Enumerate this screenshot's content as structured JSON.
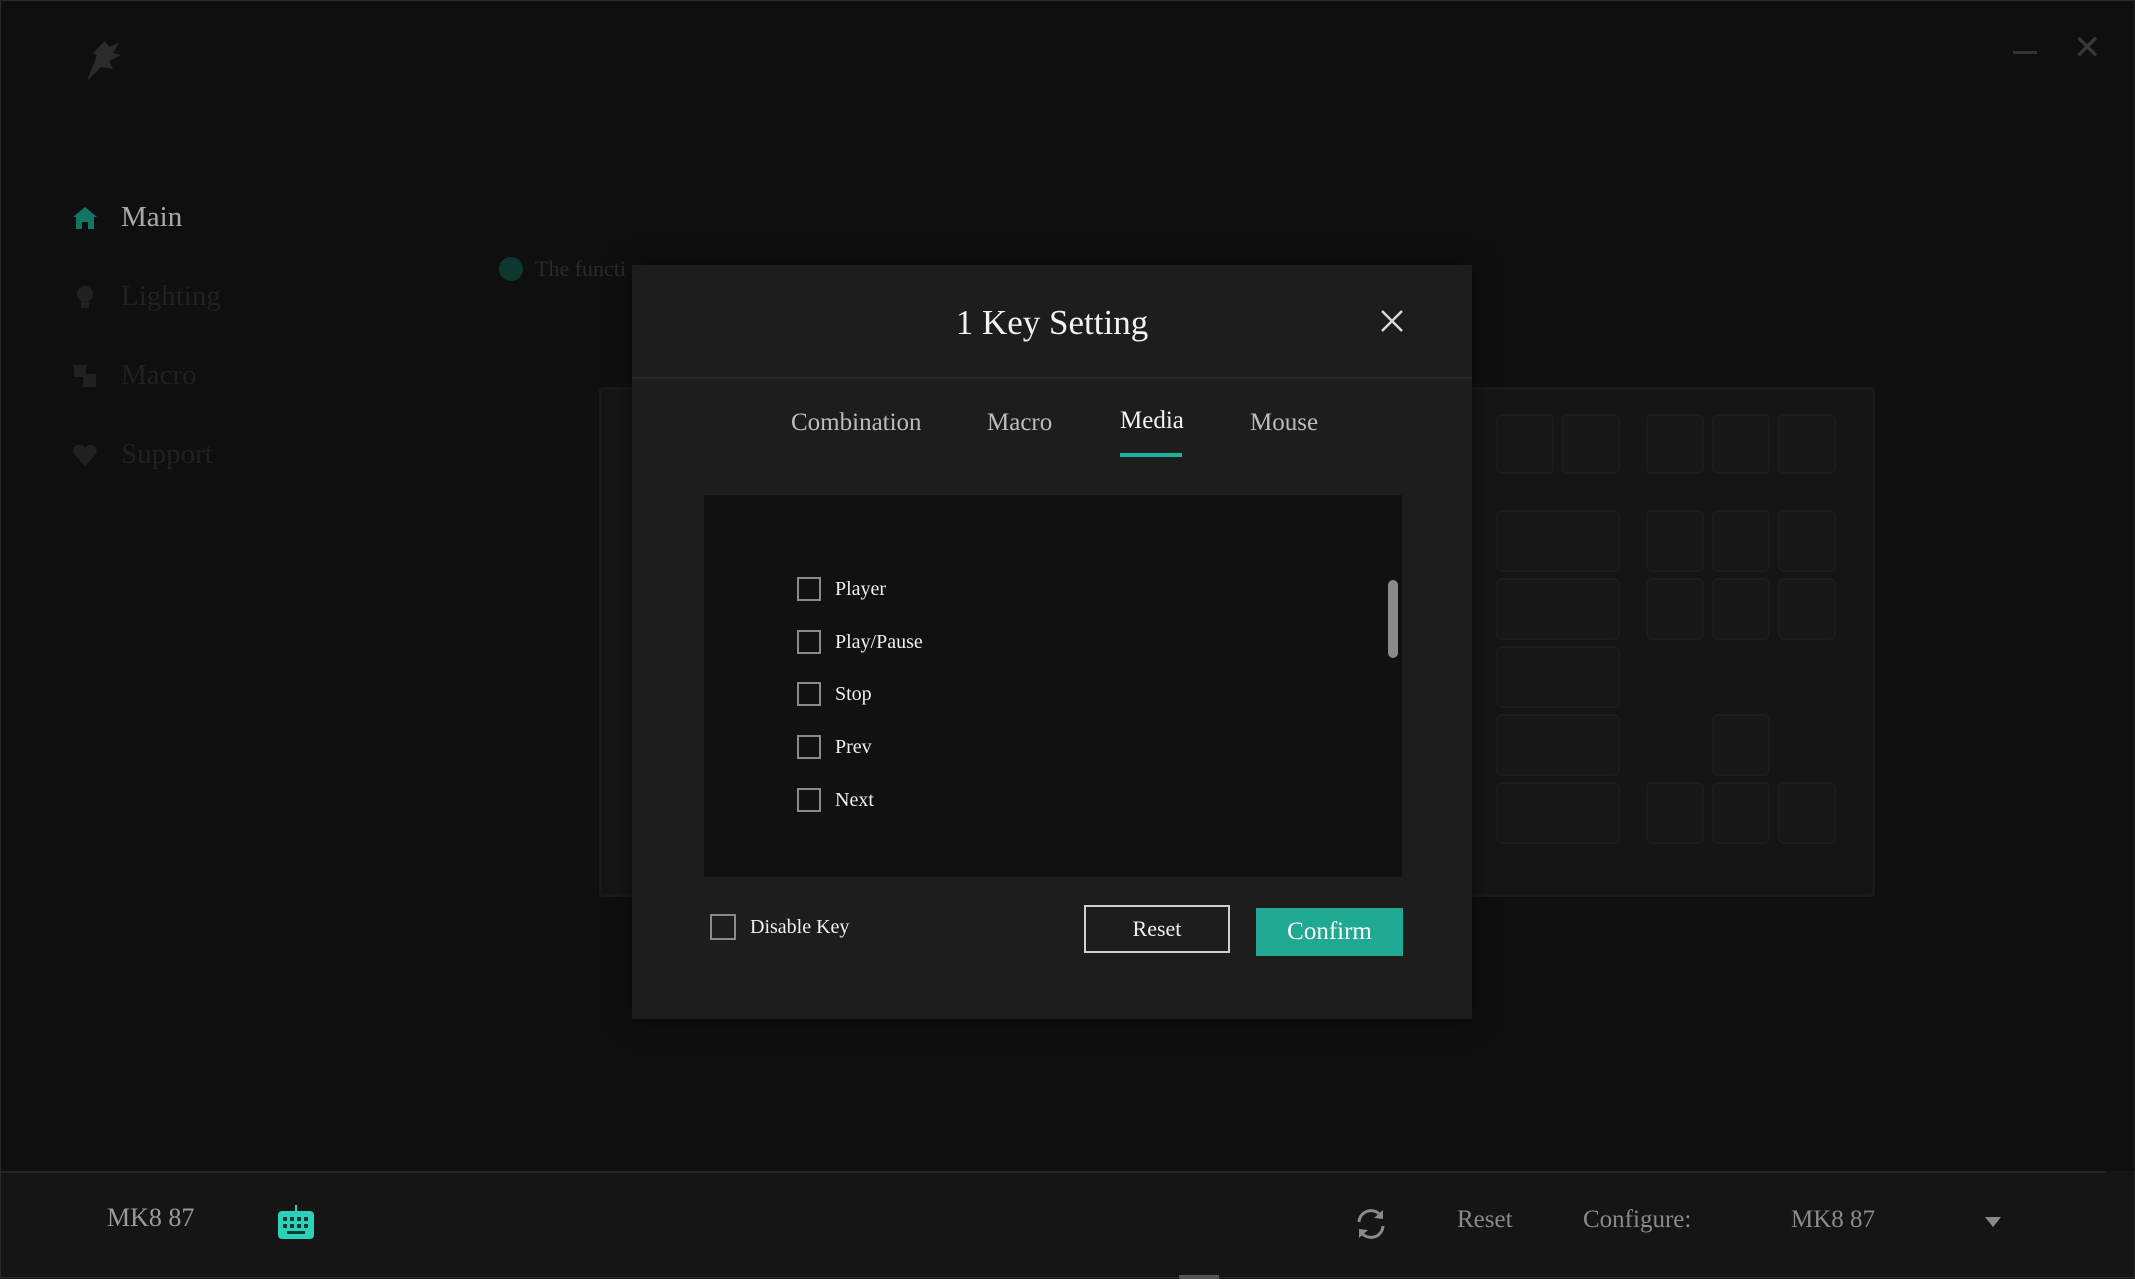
{
  "sidebar": {
    "items": [
      {
        "label": "Main",
        "icon": "home-icon"
      },
      {
        "label": "Lighting",
        "icon": "bulb-icon"
      },
      {
        "label": "Macro",
        "icon": "macro-icon"
      },
      {
        "label": "Support",
        "icon": "heart-icon"
      }
    ]
  },
  "hint": {
    "text": "The functi"
  },
  "modal": {
    "title": "1 Key Setting",
    "tabs": [
      {
        "label": "Combination"
      },
      {
        "label": "Macro"
      },
      {
        "label": "Media"
      },
      {
        "label": "Mouse"
      }
    ],
    "active_tab": "Media",
    "options": [
      {
        "label": "Player",
        "checked": false
      },
      {
        "label": "Play/Pause",
        "checked": false
      },
      {
        "label": "Stop",
        "checked": false
      },
      {
        "label": "Prev",
        "checked": false
      },
      {
        "label": "Next",
        "checked": false
      }
    ],
    "disable_key_label": "Disable Key",
    "reset_label": "Reset",
    "confirm_label": "Confirm"
  },
  "footer": {
    "device_name": "MK8 87",
    "reset_label": "Reset",
    "configure_label": "Configure:",
    "configure_value": "MK8 87"
  },
  "colors": {
    "accent": "#1fa892",
    "background": "#151515",
    "modal": "#1d1d1d",
    "panel": "#111111"
  }
}
